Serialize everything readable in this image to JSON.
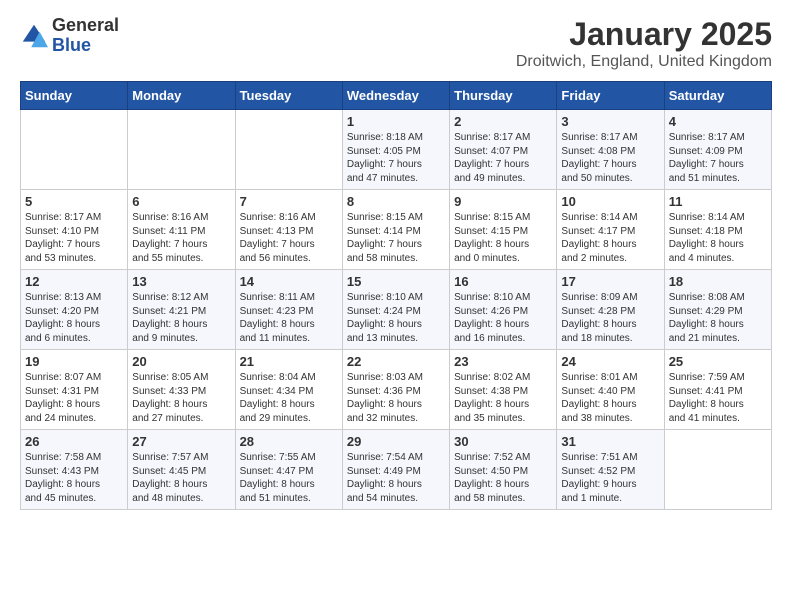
{
  "logo": {
    "general": "General",
    "blue": "Blue"
  },
  "title": "January 2025",
  "subtitle": "Droitwich, England, United Kingdom",
  "headers": [
    "Sunday",
    "Monday",
    "Tuesday",
    "Wednesday",
    "Thursday",
    "Friday",
    "Saturday"
  ],
  "weeks": [
    [
      {
        "day": "",
        "detail": ""
      },
      {
        "day": "",
        "detail": ""
      },
      {
        "day": "",
        "detail": ""
      },
      {
        "day": "1",
        "detail": "Sunrise: 8:18 AM\nSunset: 4:05 PM\nDaylight: 7 hours\nand 47 minutes."
      },
      {
        "day": "2",
        "detail": "Sunrise: 8:17 AM\nSunset: 4:07 PM\nDaylight: 7 hours\nand 49 minutes."
      },
      {
        "day": "3",
        "detail": "Sunrise: 8:17 AM\nSunset: 4:08 PM\nDaylight: 7 hours\nand 50 minutes."
      },
      {
        "day": "4",
        "detail": "Sunrise: 8:17 AM\nSunset: 4:09 PM\nDaylight: 7 hours\nand 51 minutes."
      }
    ],
    [
      {
        "day": "5",
        "detail": "Sunrise: 8:17 AM\nSunset: 4:10 PM\nDaylight: 7 hours\nand 53 minutes."
      },
      {
        "day": "6",
        "detail": "Sunrise: 8:16 AM\nSunset: 4:11 PM\nDaylight: 7 hours\nand 55 minutes."
      },
      {
        "day": "7",
        "detail": "Sunrise: 8:16 AM\nSunset: 4:13 PM\nDaylight: 7 hours\nand 56 minutes."
      },
      {
        "day": "8",
        "detail": "Sunrise: 8:15 AM\nSunset: 4:14 PM\nDaylight: 7 hours\nand 58 minutes."
      },
      {
        "day": "9",
        "detail": "Sunrise: 8:15 AM\nSunset: 4:15 PM\nDaylight: 8 hours\nand 0 minutes."
      },
      {
        "day": "10",
        "detail": "Sunrise: 8:14 AM\nSunset: 4:17 PM\nDaylight: 8 hours\nand 2 minutes."
      },
      {
        "day": "11",
        "detail": "Sunrise: 8:14 AM\nSunset: 4:18 PM\nDaylight: 8 hours\nand 4 minutes."
      }
    ],
    [
      {
        "day": "12",
        "detail": "Sunrise: 8:13 AM\nSunset: 4:20 PM\nDaylight: 8 hours\nand 6 minutes."
      },
      {
        "day": "13",
        "detail": "Sunrise: 8:12 AM\nSunset: 4:21 PM\nDaylight: 8 hours\nand 9 minutes."
      },
      {
        "day": "14",
        "detail": "Sunrise: 8:11 AM\nSunset: 4:23 PM\nDaylight: 8 hours\nand 11 minutes."
      },
      {
        "day": "15",
        "detail": "Sunrise: 8:10 AM\nSunset: 4:24 PM\nDaylight: 8 hours\nand 13 minutes."
      },
      {
        "day": "16",
        "detail": "Sunrise: 8:10 AM\nSunset: 4:26 PM\nDaylight: 8 hours\nand 16 minutes."
      },
      {
        "day": "17",
        "detail": "Sunrise: 8:09 AM\nSunset: 4:28 PM\nDaylight: 8 hours\nand 18 minutes."
      },
      {
        "day": "18",
        "detail": "Sunrise: 8:08 AM\nSunset: 4:29 PM\nDaylight: 8 hours\nand 21 minutes."
      }
    ],
    [
      {
        "day": "19",
        "detail": "Sunrise: 8:07 AM\nSunset: 4:31 PM\nDaylight: 8 hours\nand 24 minutes."
      },
      {
        "day": "20",
        "detail": "Sunrise: 8:05 AM\nSunset: 4:33 PM\nDaylight: 8 hours\nand 27 minutes."
      },
      {
        "day": "21",
        "detail": "Sunrise: 8:04 AM\nSunset: 4:34 PM\nDaylight: 8 hours\nand 29 minutes."
      },
      {
        "day": "22",
        "detail": "Sunrise: 8:03 AM\nSunset: 4:36 PM\nDaylight: 8 hours\nand 32 minutes."
      },
      {
        "day": "23",
        "detail": "Sunrise: 8:02 AM\nSunset: 4:38 PM\nDaylight: 8 hours\nand 35 minutes."
      },
      {
        "day": "24",
        "detail": "Sunrise: 8:01 AM\nSunset: 4:40 PM\nDaylight: 8 hours\nand 38 minutes."
      },
      {
        "day": "25",
        "detail": "Sunrise: 7:59 AM\nSunset: 4:41 PM\nDaylight: 8 hours\nand 41 minutes."
      }
    ],
    [
      {
        "day": "26",
        "detail": "Sunrise: 7:58 AM\nSunset: 4:43 PM\nDaylight: 8 hours\nand 45 minutes."
      },
      {
        "day": "27",
        "detail": "Sunrise: 7:57 AM\nSunset: 4:45 PM\nDaylight: 8 hours\nand 48 minutes."
      },
      {
        "day": "28",
        "detail": "Sunrise: 7:55 AM\nSunset: 4:47 PM\nDaylight: 8 hours\nand 51 minutes."
      },
      {
        "day": "29",
        "detail": "Sunrise: 7:54 AM\nSunset: 4:49 PM\nDaylight: 8 hours\nand 54 minutes."
      },
      {
        "day": "30",
        "detail": "Sunrise: 7:52 AM\nSunset: 4:50 PM\nDaylight: 8 hours\nand 58 minutes."
      },
      {
        "day": "31",
        "detail": "Sunrise: 7:51 AM\nSunset: 4:52 PM\nDaylight: 9 hours\nand 1 minute."
      },
      {
        "day": "",
        "detail": ""
      }
    ]
  ]
}
